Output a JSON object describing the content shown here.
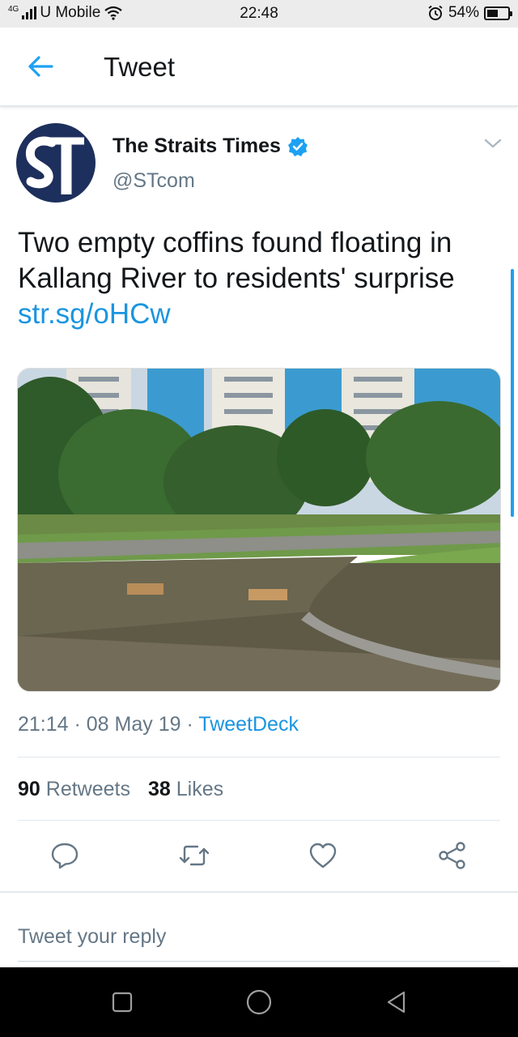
{
  "status_bar": {
    "network": "4G",
    "carrier": "U Mobile",
    "time": "22:48",
    "battery": "54%",
    "battery_level": 0.54
  },
  "header": {
    "title": "Tweet"
  },
  "tweet": {
    "author_name": "The Straits Times",
    "handle": "@STcom",
    "text": "Two empty coffins found floating in Kallang River to residents' surprise ",
    "link": "str.sg/oHCw",
    "time": "21:14",
    "date": "08 May 19",
    "source": "TweetDeck",
    "retweets_count": "90",
    "retweets_label": "Retweets",
    "likes_count": "38",
    "likes_label": "Likes"
  },
  "reply": {
    "placeholder": "Tweet your reply"
  },
  "colors": {
    "accent": "#1da1f2",
    "link": "#1b95e0",
    "secondary_text": "#657786",
    "avatar_bg": "#1d2f5c"
  },
  "icons": [
    "wifi-icon",
    "alarm-icon",
    "battery-icon",
    "back-arrow-icon",
    "verified-icon",
    "chevron-down-icon",
    "reply-icon",
    "retweet-icon",
    "like-icon",
    "share-icon",
    "recent-apps-icon",
    "home-icon",
    "back-icon"
  ]
}
